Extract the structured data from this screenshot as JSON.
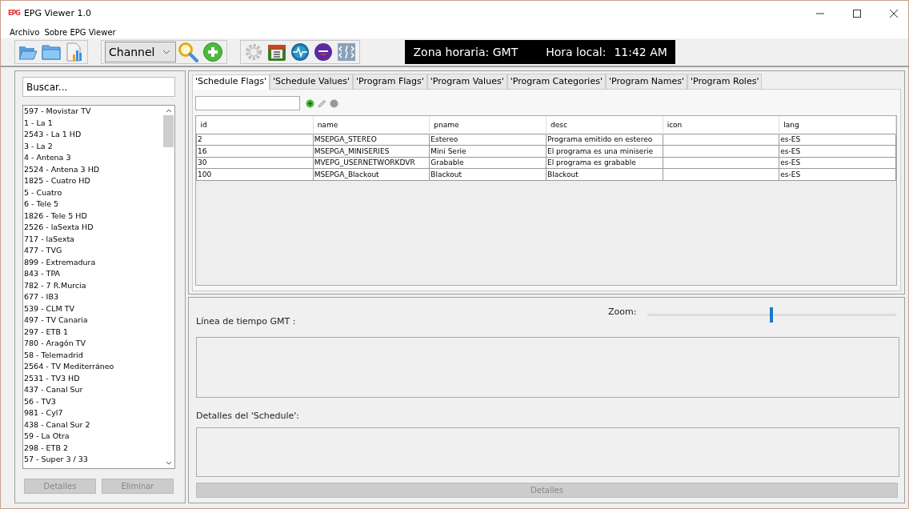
{
  "window": {
    "title": "EPG Viewer 1.0",
    "logo": "EPG"
  },
  "menu": [
    "Archivo",
    "Sobre EPG Viewer"
  ],
  "toolbar": {
    "channel_select": "Channel",
    "timezone": "Zona horaria: GMT",
    "local_time_label": "Hora local:",
    "local_time": "11:42 AM"
  },
  "sidebar": {
    "search": {
      "placeholder": "Buscar..."
    },
    "channels": [
      "597 - Movistar TV",
      "1 - La 1",
      "2543 - La 1 HD",
      "3 - La 2",
      "4 - Antena 3",
      "2524 - Antena 3 HD",
      "1825 - Cuatro HD",
      "5 - Cuatro",
      "6 - Tele 5",
      "1826 - Tele 5 HD",
      "2526 - laSexta HD",
      "717 - laSexta",
      "477 - TVG",
      "899 - Extremadura",
      "843 - TPA",
      "782 - 7 R.Murcia",
      "677 - IB3",
      "539 - CLM TV",
      "497 - TV Canaria",
      "297 - ETB 1",
      "780 - Aragón TV",
      "58 - Telemadrid",
      "2564 - TV Mediterráneo",
      "2531 - TV3 HD",
      "437 - Canal Sur",
      "56 - TV3",
      "981 - Cyl7",
      "438 - Canal Sur 2",
      "59 - La Otra",
      "298 - ETB 2",
      "57 - Super 3 / 33"
    ],
    "buttons": [
      {
        "label": "Detalles",
        "disabled": true
      },
      {
        "label": "Eliminar",
        "disabled": true
      }
    ]
  },
  "tabs": [
    {
      "label": "'Schedule Flags'",
      "selected": true
    },
    {
      "label": "'Schedule Values'",
      "selected": false
    },
    {
      "label": "'Program Flags'",
      "selected": false
    },
    {
      "label": "'Program Values'",
      "selected": false
    },
    {
      "label": "'Program Categories'",
      "selected": false
    },
    {
      "label": "'Program Names'",
      "selected": false
    },
    {
      "label": "'Program Roles'",
      "selected": false
    }
  ],
  "table": {
    "columns": [
      "id",
      "name",
      "pname",
      "desc",
      "icon",
      "lang"
    ],
    "rows": [
      [
        "2",
        "MSEPGA_STEREO",
        "Estereo",
        "Programa emitido en estereo",
        "",
        "es-ES"
      ],
      [
        "16",
        "MSEPGA_MINISERIES",
        "Mini Serie",
        "El programa es una miniserie",
        "",
        "es-ES"
      ],
      [
        "30",
        "MVEPG_USERNETWORKDVR",
        "Grabable",
        "El programa es grabable",
        "",
        "es-ES"
      ],
      [
        "100",
        "MSEPGA_Blackout",
        "Blackout",
        "Blackout",
        "",
        "es-ES"
      ]
    ]
  },
  "timeline": {
    "label": "Línea de tiempo GMT :",
    "zoom_label": "Zoom:",
    "zoom": {
      "level": 0.49
    }
  },
  "details": {
    "label": "Detalles del 'Schedule':",
    "button": {
      "label": "Detalles",
      "disabled": true
    }
  }
}
